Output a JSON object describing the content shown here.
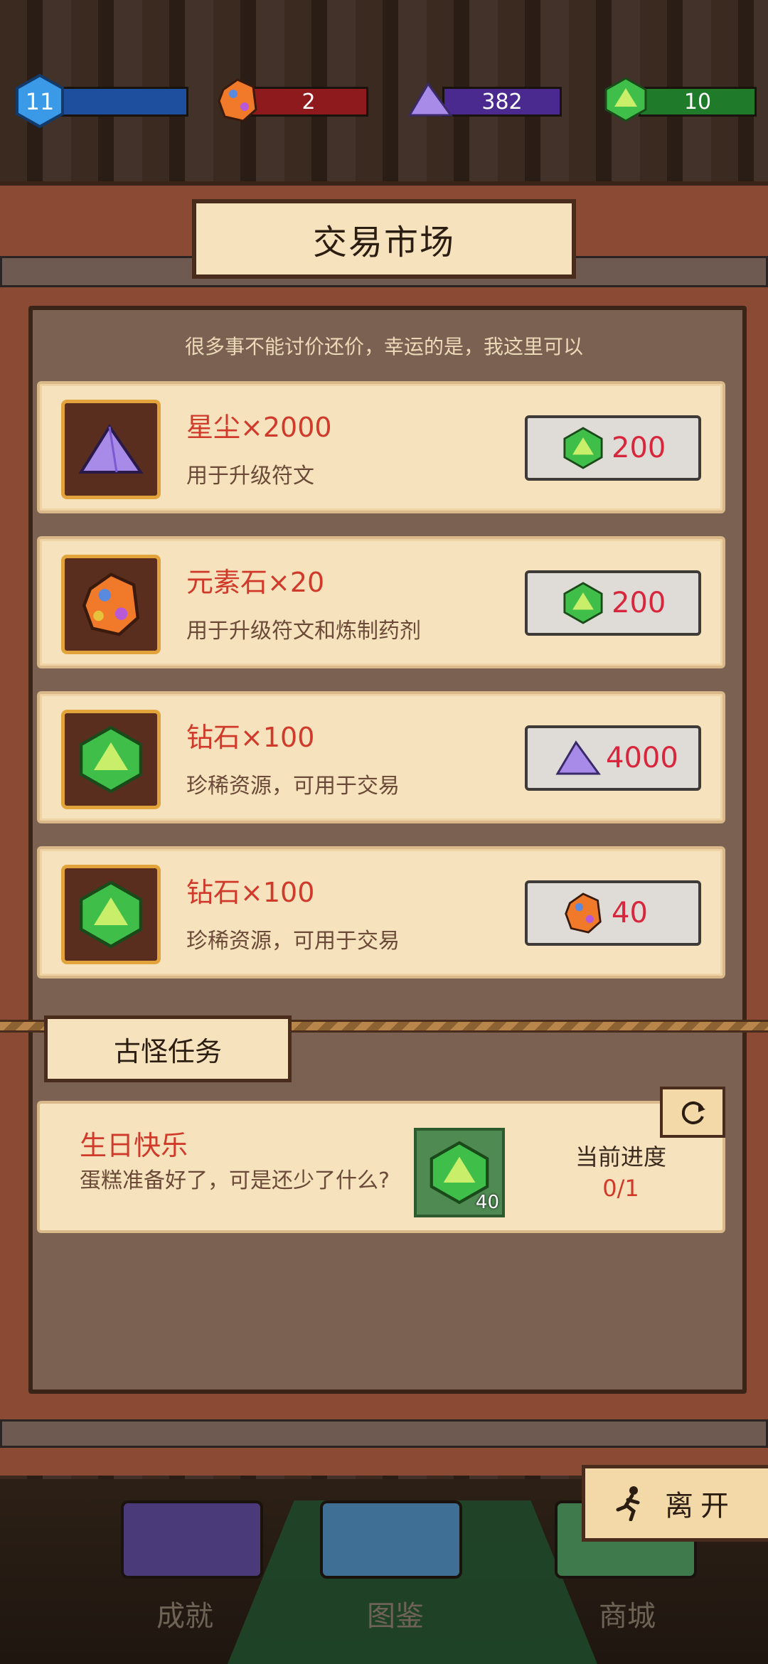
{
  "resources": {
    "level": "11",
    "element_stone": "2",
    "stardust": "382",
    "diamond": "10"
  },
  "market": {
    "title": "交易市场",
    "subtitle": "很多事不能讨价还价，幸运的是，我这里可以",
    "offers": [
      {
        "name": "星尘×2000",
        "desc": "用于升级符文",
        "item_icon": "stardust-icon",
        "cost_icon": "diamond-icon",
        "cost": "200"
      },
      {
        "name": "元素石×20",
        "desc": "用于升级符文和炼制药剂",
        "item_icon": "element-stone-icon",
        "cost_icon": "diamond-icon",
        "cost": "200"
      },
      {
        "name": "钻石×100",
        "desc": "珍稀资源，可用于交易",
        "item_icon": "diamond-icon",
        "cost_icon": "stardust-icon",
        "cost": "4000"
      },
      {
        "name": "钻石×100",
        "desc": "珍稀资源，可用于交易",
        "item_icon": "diamond-icon",
        "cost_icon": "element-stone-icon",
        "cost": "40"
      }
    ]
  },
  "quest": {
    "section_title": "古怪任务",
    "name": "生日快乐",
    "desc": "蛋糕准备好了，可是还少了什么?",
    "reward_icon": "diamond-icon",
    "reward_count": "40",
    "progress_label": "当前进度",
    "progress_value": "0/1"
  },
  "leave_label": "离开",
  "nav": {
    "achievements": "成就",
    "codex": "图鉴",
    "shop": "商城"
  },
  "colors": {
    "level_bar": "#1e4f9e",
    "stone_bar": "#8f1a1d",
    "stardust_bar": "#4a2a8e",
    "diamond_bar": "#1f7a2a",
    "accent_red": "#d03a2a"
  }
}
